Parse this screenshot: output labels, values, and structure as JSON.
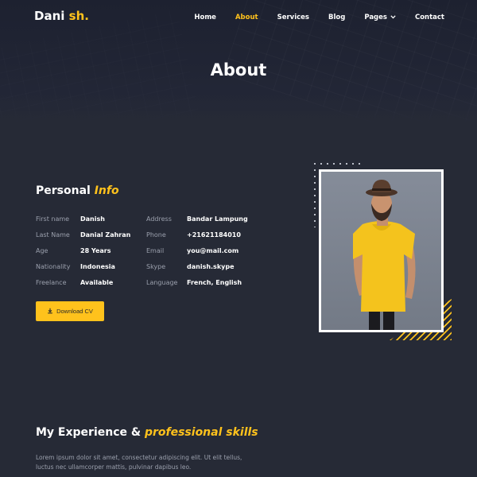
{
  "brand": {
    "name": "Dani",
    "accent": "sh."
  },
  "nav": {
    "items": [
      {
        "label": "Home",
        "active": false
      },
      {
        "label": "About",
        "active": true
      },
      {
        "label": "Services",
        "active": false
      },
      {
        "label": "Blog",
        "active": false
      },
      {
        "label": "Pages",
        "active": false,
        "dropdown": true
      },
      {
        "label": "Contact",
        "active": false
      }
    ]
  },
  "hero": {
    "title": "About"
  },
  "personal": {
    "title_plain": "Personal",
    "title_accent": "Info",
    "left": [
      {
        "label": "First name",
        "value": "Danish"
      },
      {
        "label": "Last Name",
        "value": "Danial Zahran"
      },
      {
        "label": "Age",
        "value": "28 Years"
      },
      {
        "label": "Nationality",
        "value": "Indonesia"
      },
      {
        "label": "Freelance",
        "value": "Available"
      }
    ],
    "right": [
      {
        "label": "Address",
        "value": "Bandar Lampung"
      },
      {
        "label": "Phone",
        "value": "+21621184010"
      },
      {
        "label": "Email",
        "value": "you@mail.com"
      },
      {
        "label": "Skype",
        "value": "danish.skype"
      },
      {
        "label": "Language",
        "value": "French, English"
      }
    ],
    "download_label": "Download CV"
  },
  "experience": {
    "title_plain": "My Experience &",
    "title_accent": "professional skills",
    "text": "Lorem ipsum dolor sit amet, consectetur adipiscing elit. Ut elit tellus, luctus nec ullamcorper mattis, pulvinar dapibus leo."
  },
  "colors": {
    "accent": "#ffc21c",
    "background": "#262a36",
    "muted": "#9ba0ad"
  }
}
